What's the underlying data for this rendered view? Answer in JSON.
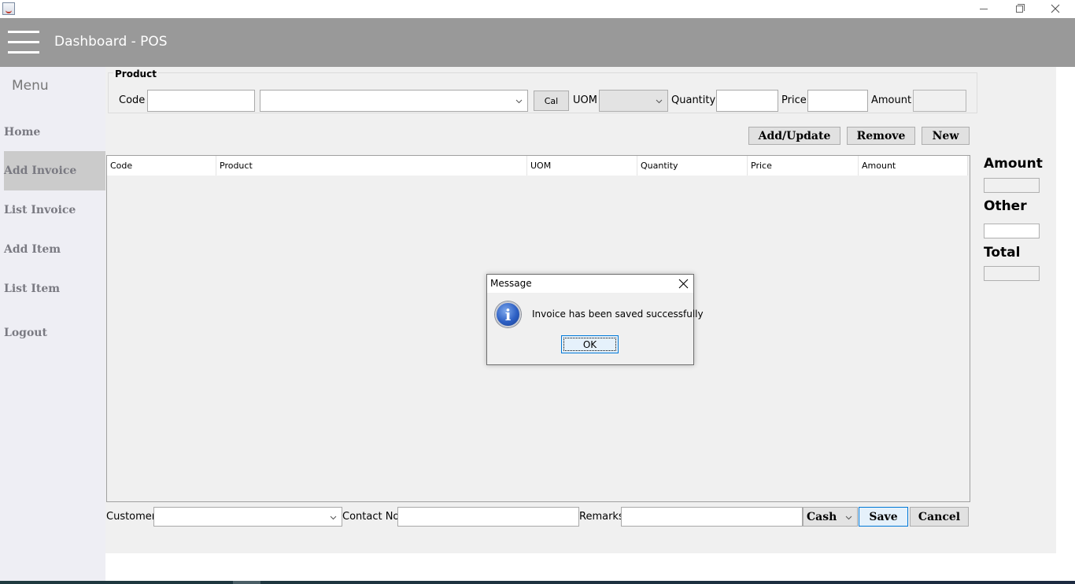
{
  "window": {
    "icon": "java-cup-icon",
    "controls": {
      "minimize": "minimize-icon",
      "maximize": "restore-icon",
      "close": "close-icon"
    }
  },
  "header": {
    "menu_icon": "hamburger-icon",
    "title": "Dashboard - POS"
  },
  "sidebar": {
    "title": "Menu",
    "items": [
      {
        "label": "Home",
        "active": false
      },
      {
        "label": "Add Invoice",
        "active": true
      },
      {
        "label": "List Invoice",
        "active": false
      },
      {
        "label": "Add Item",
        "active": false
      },
      {
        "label": "List Item",
        "active": false
      },
      {
        "label": "Logout",
        "active": false
      }
    ]
  },
  "product": {
    "group_label": "Product",
    "code_label": "Code",
    "code_value": "",
    "product_value": "",
    "cal_button": "Cal",
    "uom_label": "UOM",
    "uom_value": "",
    "quantity_label": "Quantity",
    "quantity_value": "",
    "price_label": "Price",
    "price_value": "",
    "amount_label": "Amount",
    "amount_value": ""
  },
  "actions": {
    "add_update": "Add/Update",
    "remove": "Remove",
    "new": "New"
  },
  "table": {
    "columns": [
      "Code",
      "Product",
      "UOM",
      "Quantity",
      "Price",
      "Amount"
    ],
    "rows": []
  },
  "summary": {
    "amount_label": "Amount",
    "amount_value": "",
    "other_label": "Other",
    "other_value": "",
    "total_label": "Total",
    "total_value": ""
  },
  "footer": {
    "customer_label": "Customer",
    "customer_value": "",
    "contact_label": "Contact No",
    "contact_value": "",
    "remarks_label": "Remarks",
    "remarks_value": "",
    "payment_type": "Cash",
    "save": "Save",
    "cancel": "Cancel"
  },
  "dialog": {
    "title": "Message",
    "icon": "info-icon",
    "message": "Invoice has been saved successfully",
    "ok": "OK"
  },
  "colors": {
    "header_bg": "#999999",
    "sidebar_bg": "#eeeef4",
    "active_item_bg": "#cbcbcb",
    "panel_bg": "#f0f0f0",
    "focus_border": "#0078d7"
  }
}
